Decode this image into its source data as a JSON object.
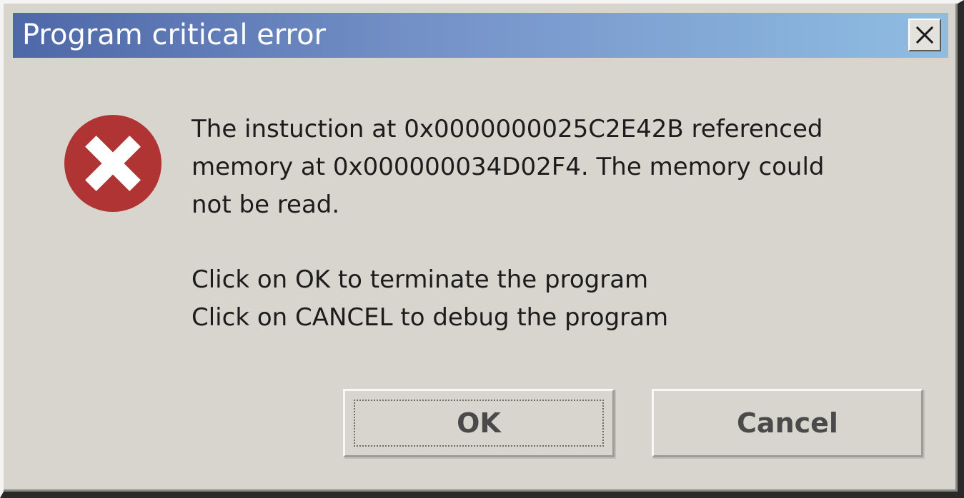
{
  "window": {
    "title": "Program critical error",
    "close_icon": "close-icon"
  },
  "message": {
    "icon": "error-x-icon",
    "icon_color": "#b03434",
    "lines": [
      "The instuction at 0x0000000025C2E42B referenced",
      "memory at 0x000000034D02F4. The memory could",
      "not be read."
    ],
    "instructions": [
      "Click on OK to terminate the program",
      "Click on CANCEL to debug the program"
    ]
  },
  "buttons": {
    "ok_label": "OK",
    "cancel_label": "Cancel"
  }
}
